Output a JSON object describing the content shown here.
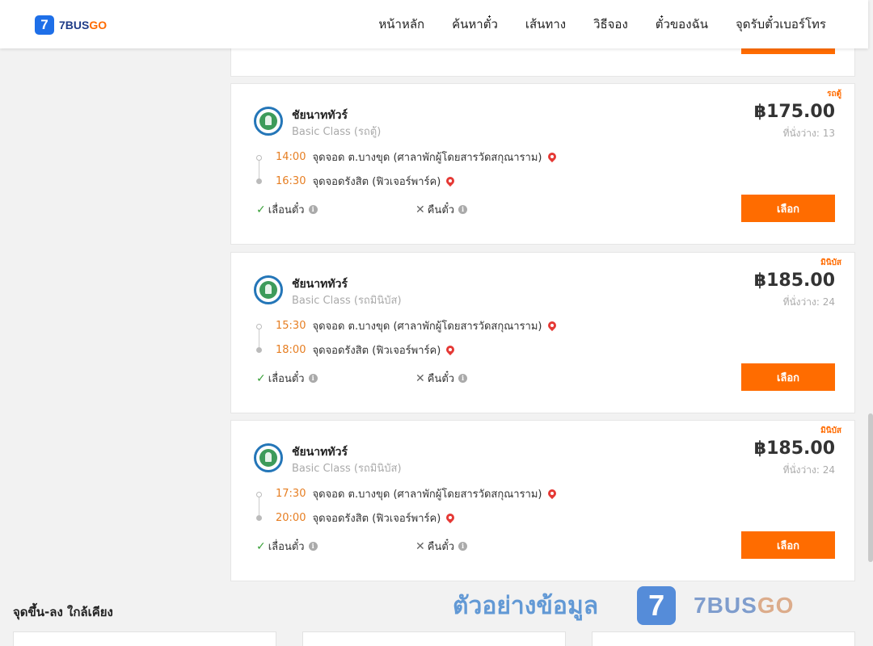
{
  "header": {
    "logo": {
      "mark": "7",
      "brand_main": "7BUS",
      "brand_accent": "GO"
    },
    "nav": [
      "หน้าหลัก",
      "ค้นหาตั๋ว",
      "เส้นทาง",
      "วิธีจอง",
      "ตั๋วของฉัน",
      "จุดรับตั๋วเบอร์โทร"
    ]
  },
  "trips": [
    {
      "badge": "รถตู้",
      "operator": "ชัยนาททัวร์",
      "class": "Basic Class (รถตู้)",
      "price": "฿175.00",
      "seats": "ที่นั่งว่าง: 13",
      "depart_time": "14:00",
      "depart_stop": "จุดจอด ต.บางขุด (ศาลาพักผู้โดยสารวัดสกุณาราม)",
      "arrive_time": "16:30",
      "arrive_stop": "จุดจอดรังสิต (ฟิวเจอร์พาร์ค)",
      "change_label": "เลื่อนตั๋ว",
      "refund_label": "คืนตั๋ว",
      "select_label": "เลือก"
    },
    {
      "badge": "มินิบัส",
      "operator": "ชัยนาททัวร์",
      "class": "Basic Class (รถมินิบัส)",
      "price": "฿185.00",
      "seats": "ที่นั่งว่าง: 24",
      "depart_time": "15:30",
      "depart_stop": "จุดจอด ต.บางขุด (ศาลาพักผู้โดยสารวัดสกุณาราม)",
      "arrive_time": "18:00",
      "arrive_stop": "จุดจอดรังสิต (ฟิวเจอร์พาร์ค)",
      "change_label": "เลื่อนตั๋ว",
      "refund_label": "คืนตั๋ว",
      "select_label": "เลือก"
    },
    {
      "badge": "มินิบัส",
      "operator": "ชัยนาททัวร์",
      "class": "Basic Class (รถมินิบัส)",
      "price": "฿185.00",
      "seats": "ที่นั่งว่าง: 24",
      "depart_time": "17:30",
      "depart_stop": "จุดจอด ต.บางขุด (ศาลาพักผู้โดยสารวัดสกุณาราม)",
      "arrive_time": "20:00",
      "arrive_stop": "จุดจอดรังสิต (ฟิวเจอร์พาร์ค)",
      "change_label": "เลื่อนตั๋ว",
      "refund_label": "คืนตั๋ว",
      "select_label": "เลือก"
    }
  ],
  "nearby": {
    "title": "จุดขึ้น-ลง ใกล้เคียง"
  },
  "watermark": {
    "text": "ตัวอย่างข้อมูล",
    "mark": "7",
    "brand_main": "7BUS",
    "brand_accent": "GO"
  },
  "icons": {
    "check": "check-icon",
    "cross": "cross-icon",
    "info": "info-icon",
    "pin": "map-pin-icon",
    "operator_logo": "operator-logo"
  },
  "colors": {
    "accent": "#ff6c00",
    "brand": "#1e6fe8",
    "time": "#e67e22",
    "pin": "#e53935",
    "check": "#3aa13a"
  }
}
